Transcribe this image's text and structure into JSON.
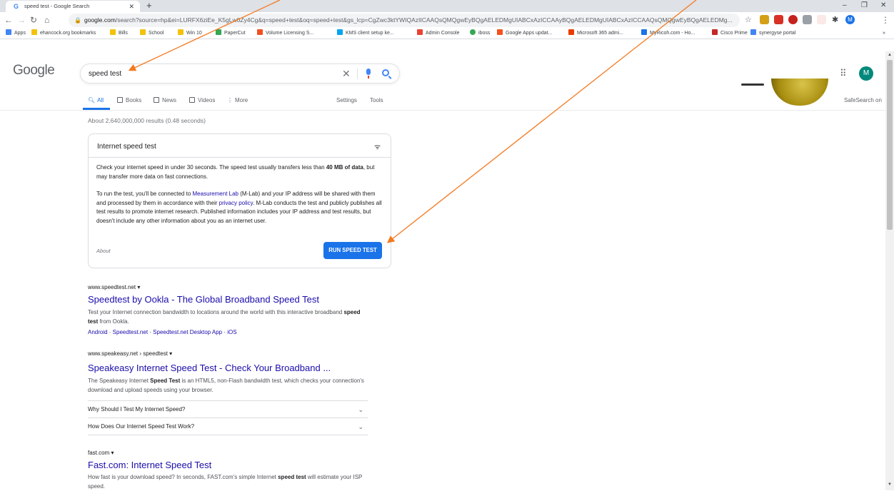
{
  "browser": {
    "tab_title": "speed test - Google Search",
    "tab_favicon": "G",
    "tab_close": "✕",
    "new_tab": "+",
    "url_host": "google.com",
    "url_rest": "/search?source=hp&ei=LURFX6ziEe_K5gLw0Zy4Cg&q=speed+test&oq=speed+test&gs_lcp=CgZwc3ktYWIQAzIICAAQsQMQgwEyBQgAELEDMgUIABCxAzICCAAyBQgAELEDMgUIABCxAzICCAAQsQMQgwEyBQgAELEDMg...",
    "profile_initial": "M",
    "window_controls": [
      "–",
      "❐",
      "✕"
    ]
  },
  "bookmarks": [
    {
      "label": "Apps",
      "color": "#4285f4"
    },
    {
      "label": "ehancock.org bookmarks",
      "color": "#f4c20d"
    },
    {
      "label": "Bills",
      "color": "#f4c20d"
    },
    {
      "label": "School",
      "color": "#f4c20d"
    },
    {
      "label": "Win 10",
      "color": "#f4c20d"
    },
    {
      "label": "PaperCut",
      "color": "#34a853"
    },
    {
      "label": "Volume Licensing S...",
      "color": "#f25022"
    },
    {
      "label": "KMS client setup ke...",
      "color": "#00a4ef"
    },
    {
      "label": "Admin Console",
      "color": "#ea4335"
    },
    {
      "label": "iboss",
      "color": "#34a853"
    },
    {
      "label": "Google Apps updat...",
      "color": "#f4511e"
    },
    {
      "label": "Microsoft 365 admi...",
      "color": "#eb3c00"
    },
    {
      "label": "MyRicoh.com - Ho...",
      "color": "#1a73e8"
    },
    {
      "label": "Cisco Prime",
      "color": "#c62828"
    },
    {
      "label": "synergyse portal",
      "color": "#4285f4"
    }
  ],
  "google": {
    "logo": "Google",
    "query": "speed test",
    "profile_initial": "M",
    "safesearch": "SafeSearch on",
    "tabs": [
      "All",
      "Books",
      "News",
      "Videos",
      "More"
    ],
    "tools": [
      "Settings",
      "Tools"
    ],
    "result_stats": "About 2,640,000,000 results (0.48 seconds)"
  },
  "card": {
    "title": "Internet speed test",
    "p1_a": "Check your internet speed in under 30 seconds. The speed test usually transfers less than ",
    "p1_bold1": "40 MB of",
    "p1_bold2": "data",
    "p1_b": ", but may transfer more data on fast connections.",
    "p2_a": "To run the test, you'll be connected to ",
    "p2_link1": "Measurement Lab",
    "p2_b": " (M-Lab) and your IP address will be shared with them and processed by them in accordance with their ",
    "p2_link2": "privacy policy",
    "p2_c": ". M-Lab conducts the test and publicly publishes all test results to promote internet research. Published information includes your IP address and test results, but doesn't include any other information about you as an internet user.",
    "about": "About",
    "button": "RUN SPEED TEST"
  },
  "results": [
    {
      "cite": "www.speedtest.net ▾",
      "title": "Speedtest by Ookla - The Global Broadband Speed Test",
      "snippet_a": "Test your Internet connection bandwidth to locations around the world with this interactive broadband ",
      "snippet_bold": "speed test",
      "snippet_b": " from Ookla.",
      "sitelinks": "Android · Speedtest.net · Speedtest.net Desktop App · iOS"
    },
    {
      "cite": "www.speakeasy.net › speedtest ▾",
      "title": "Speakeasy Internet Speed Test - Check Your Broadband ...",
      "snippet_a": "The Speakeasy Internet ",
      "snippet_bold": "Speed Test",
      "snippet_b": " is an HTML5, non-Flash bandwidth test, which checks your connection's download and upload speeds using your browser.",
      "faqs": [
        "Why Should I Test My Internet Speed?",
        "How Does Our Internet Speed Test Work?"
      ]
    },
    {
      "cite": "fast.com ▾",
      "title": "Fast.com: Internet Speed Test",
      "snippet_a": "How fast is your download speed? In seconds, FAST.com's simple Internet ",
      "snippet_bold": "speed test",
      "snippet_b": " will estimate your ISP speed."
    }
  ],
  "colors": {
    "accent": "#1a73e8",
    "annotation_arrow": "#f47920",
    "link": "#1a0dab"
  }
}
